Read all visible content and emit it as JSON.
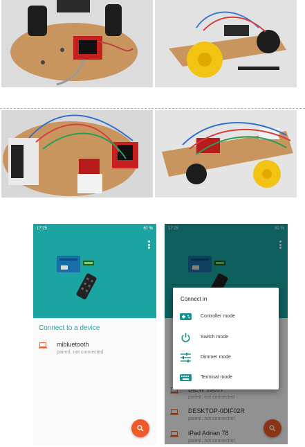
{
  "colors": {
    "teal": "#1ba4a2",
    "teal_dark": "#0e5b59",
    "fab": "#f05a28",
    "device_icon": "#e8623a",
    "mode_icon": "#1b8f8d"
  },
  "photos": [
    {
      "subject": "robot car chassis with motor driver, top view"
    },
    {
      "subject": "robot car chassis with yellow wheel, side view"
    },
    {
      "subject": "robot car with Arduino board and wiring"
    },
    {
      "subject": "robot car with wiring and yellow wheels"
    }
  ],
  "phone_left": {
    "status": {
      "time": "17:25",
      "battery": "61 %"
    },
    "section_title": "Connect to a device",
    "devices": [
      {
        "icon": "laptop-icon",
        "name": "mibluetooth",
        "status": "paired, not connected"
      }
    ],
    "fab_icon": "search-icon"
  },
  "phone_right": {
    "status": {
      "time": "17:25",
      "battery": "61 %"
    },
    "dialog": {
      "title": "Connect in",
      "options": [
        {
          "icon": "gamepad-icon",
          "label": "Controller mode"
        },
        {
          "icon": "power-icon",
          "label": "Switch mode"
        },
        {
          "icon": "sliders-icon",
          "label": "Dimmer mode"
        },
        {
          "icon": "keyboard-icon",
          "label": "Terminal mode"
        }
      ]
    },
    "devices": [
      {
        "icon": "laptop-icon",
        "name": "DIEW 9900T",
        "status": "paired, not connected"
      },
      {
        "icon": "laptop-icon",
        "name": "DESKTOP-0DIF02R",
        "status": "paired, not connected"
      },
      {
        "icon": "laptop-icon",
        "name": "iPad Adrian 78",
        "status": "paired, not connected"
      }
    ],
    "fab_icon": "search-icon"
  }
}
